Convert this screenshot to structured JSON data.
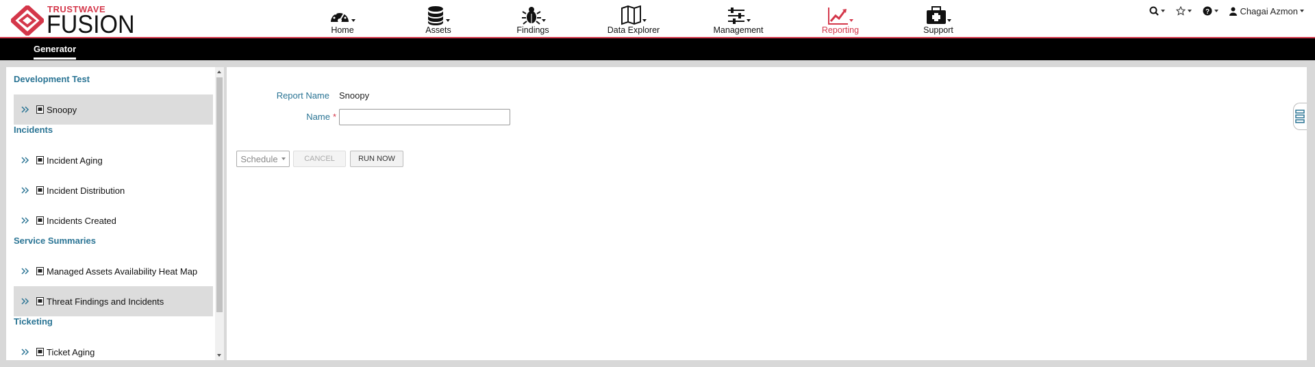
{
  "brand": {
    "company": "TRUSTWAVE",
    "product": "FUSION",
    "accent_color": "#d4374a"
  },
  "nav": {
    "items": [
      {
        "label": "Home",
        "icon": "dashboard-icon"
      },
      {
        "label": "Assets",
        "icon": "database-icon"
      },
      {
        "label": "Findings",
        "icon": "bug-icon"
      },
      {
        "label": "Data Explorer",
        "icon": "map-icon"
      },
      {
        "label": "Management",
        "icon": "sliders-icon"
      },
      {
        "label": "Reporting",
        "icon": "chart-line-icon",
        "active": true
      },
      {
        "label": "Support",
        "icon": "medkit-icon"
      }
    ]
  },
  "utility": {
    "user_name": "Chagai Azmon"
  },
  "subnav": {
    "tab": "Generator"
  },
  "reports": {
    "groups": [
      {
        "title": "Development Test",
        "items": [
          "Snoopy"
        ]
      },
      {
        "title": "Incidents",
        "items": [
          "Incident Aging",
          "Incident Distribution",
          "Incidents Created"
        ]
      },
      {
        "title": "Service Summaries",
        "items": [
          "Managed Assets Availability Heat Map",
          "Threat Findings and Incidents"
        ]
      },
      {
        "title": "Ticketing",
        "items": [
          "Ticket Aging"
        ]
      }
    ],
    "selected": "Snoopy"
  },
  "form": {
    "report_name_label": "Report Name",
    "report_name_value": "Snoopy",
    "name_label": "Name",
    "required_mark": "*",
    "name_value": "",
    "schedule_label": "Schedule",
    "cancel_label": "CANCEL",
    "run_label": "RUN NOW"
  }
}
